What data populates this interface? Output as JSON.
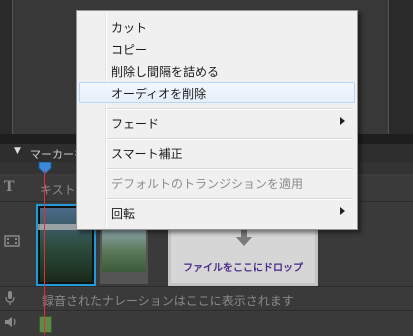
{
  "context_menu": {
    "items": [
      {
        "label": "カット",
        "disabled": false,
        "submenu": false
      },
      {
        "label": "コピー",
        "disabled": false,
        "submenu": false
      },
      {
        "label": "削除し間隔を詰める",
        "disabled": false,
        "submenu": false
      },
      {
        "label": "オーディオを削除",
        "disabled": false,
        "submenu": false,
        "hover": true
      },
      {
        "label": "フェード",
        "disabled": false,
        "submenu": true
      },
      {
        "label": "スマート補正",
        "disabled": false,
        "submenu": false
      },
      {
        "label": "デフォルトのトランジションを適用",
        "disabled": true,
        "submenu": false
      },
      {
        "label": "回転",
        "disabled": false,
        "submenu": true
      }
    ]
  },
  "timeline": {
    "marker_label": "マーカーを",
    "title_track_placeholder": "キスト",
    "drop_zone_text": "ファイルをここにドロップ",
    "narration_text": "録音されたナレーションはここに表示されます"
  },
  "colors": {
    "selection_border": "#1e9bd8",
    "playhead": "#dd3333",
    "drop_text": "#4a2a8a"
  }
}
